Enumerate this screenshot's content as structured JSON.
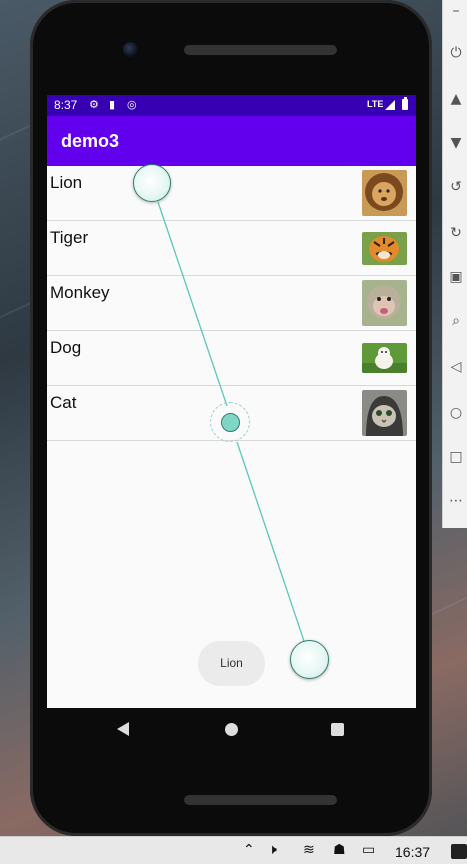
{
  "status_bar": {
    "time": "8:37",
    "icons": [
      "gear-icon",
      "sd-card-icon",
      "sync-icon"
    ],
    "network": "LTE"
  },
  "app_bar": {
    "title": "demo3"
  },
  "animals": [
    {
      "name": "Lion",
      "icon": "lion-photo"
    },
    {
      "name": "Tiger",
      "icon": "tiger-photo"
    },
    {
      "name": "Monkey",
      "icon": "monkey-photo"
    },
    {
      "name": "Dog",
      "icon": "dog-photo"
    },
    {
      "name": "Cat",
      "icon": "cat-photo"
    }
  ],
  "toast": {
    "text": "Lion"
  },
  "taskbar": {
    "time": "16:37"
  },
  "colors": {
    "status_bar": "#3700b3",
    "app_bar": "#6200ee",
    "touch_line": "#5bc8b8"
  }
}
